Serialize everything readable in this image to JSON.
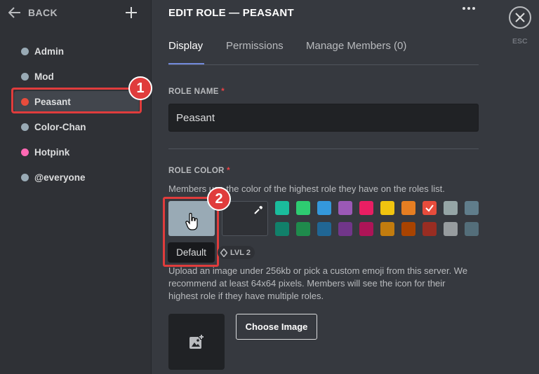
{
  "sidebar": {
    "back_label": "BACK",
    "roles": [
      {
        "name": "Admin",
        "color": "#99aab5"
      },
      {
        "name": "Mod",
        "color": "#99aab5"
      },
      {
        "name": "Peasant",
        "color": "#e74c3c"
      },
      {
        "name": "Color-Chan",
        "color": "#99aab5"
      },
      {
        "name": "Hotpink",
        "color": "#ff69b4"
      },
      {
        "name": "@everyone",
        "color": "#99aab5"
      }
    ]
  },
  "header": {
    "title": "EDIT ROLE — PEASANT",
    "esc_label": "ESC"
  },
  "tabs": [
    "Display",
    "Permissions",
    "Manage Members (0)"
  ],
  "role_name": {
    "label": "ROLE NAME",
    "required": "*",
    "value": "Peasant"
  },
  "role_color": {
    "label": "ROLE COLOR",
    "required": "*",
    "description": "Members use the color of the highest role they have on the roles list.",
    "default_tooltip": "Default",
    "selected": "#e74c3c",
    "palette_row1": [
      "#1abc9c",
      "#2ecc71",
      "#3498db",
      "#9b59b6",
      "#e91e63",
      "#f1c40f",
      "#e67e22",
      "#e74c3c",
      "#95a5a6",
      "#607d8b"
    ],
    "palette_row2": [
      "#11806a",
      "#1f8b4c",
      "#206694",
      "#71368a",
      "#ad1457",
      "#c27c0e",
      "#a84300",
      "#992d22",
      "#979c9f",
      "#546e7a"
    ]
  },
  "role_icon": {
    "level_badge": "LVL 2",
    "description": "Upload an image under 256kb or pick a custom emoji from this server. We recommend at least 64x64 pixels. Members will see the icon for their highest role if they have multiple roles.",
    "choose_button": "Choose Image"
  },
  "annotations": [
    "1",
    "2"
  ]
}
